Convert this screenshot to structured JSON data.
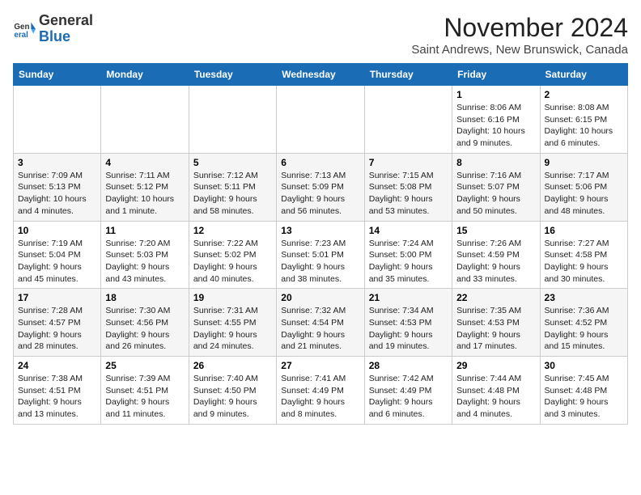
{
  "header": {
    "logo_general": "General",
    "logo_blue": "Blue",
    "month_title": "November 2024",
    "subtitle": "Saint Andrews, New Brunswick, Canada"
  },
  "days_of_week": [
    "Sunday",
    "Monday",
    "Tuesday",
    "Wednesday",
    "Thursday",
    "Friday",
    "Saturday"
  ],
  "weeks": [
    [
      {
        "day": "",
        "info": ""
      },
      {
        "day": "",
        "info": ""
      },
      {
        "day": "",
        "info": ""
      },
      {
        "day": "",
        "info": ""
      },
      {
        "day": "",
        "info": ""
      },
      {
        "day": "1",
        "info": "Sunrise: 8:06 AM\nSunset: 6:16 PM\nDaylight: 10 hours and 9 minutes."
      },
      {
        "day": "2",
        "info": "Sunrise: 8:08 AM\nSunset: 6:15 PM\nDaylight: 10 hours and 6 minutes."
      }
    ],
    [
      {
        "day": "3",
        "info": "Sunrise: 7:09 AM\nSunset: 5:13 PM\nDaylight: 10 hours and 4 minutes."
      },
      {
        "day": "4",
        "info": "Sunrise: 7:11 AM\nSunset: 5:12 PM\nDaylight: 10 hours and 1 minute."
      },
      {
        "day": "5",
        "info": "Sunrise: 7:12 AM\nSunset: 5:11 PM\nDaylight: 9 hours and 58 minutes."
      },
      {
        "day": "6",
        "info": "Sunrise: 7:13 AM\nSunset: 5:09 PM\nDaylight: 9 hours and 56 minutes."
      },
      {
        "day": "7",
        "info": "Sunrise: 7:15 AM\nSunset: 5:08 PM\nDaylight: 9 hours and 53 minutes."
      },
      {
        "day": "8",
        "info": "Sunrise: 7:16 AM\nSunset: 5:07 PM\nDaylight: 9 hours and 50 minutes."
      },
      {
        "day": "9",
        "info": "Sunrise: 7:17 AM\nSunset: 5:06 PM\nDaylight: 9 hours and 48 minutes."
      }
    ],
    [
      {
        "day": "10",
        "info": "Sunrise: 7:19 AM\nSunset: 5:04 PM\nDaylight: 9 hours and 45 minutes."
      },
      {
        "day": "11",
        "info": "Sunrise: 7:20 AM\nSunset: 5:03 PM\nDaylight: 9 hours and 43 minutes."
      },
      {
        "day": "12",
        "info": "Sunrise: 7:22 AM\nSunset: 5:02 PM\nDaylight: 9 hours and 40 minutes."
      },
      {
        "day": "13",
        "info": "Sunrise: 7:23 AM\nSunset: 5:01 PM\nDaylight: 9 hours and 38 minutes."
      },
      {
        "day": "14",
        "info": "Sunrise: 7:24 AM\nSunset: 5:00 PM\nDaylight: 9 hours and 35 minutes."
      },
      {
        "day": "15",
        "info": "Sunrise: 7:26 AM\nSunset: 4:59 PM\nDaylight: 9 hours and 33 minutes."
      },
      {
        "day": "16",
        "info": "Sunrise: 7:27 AM\nSunset: 4:58 PM\nDaylight: 9 hours and 30 minutes."
      }
    ],
    [
      {
        "day": "17",
        "info": "Sunrise: 7:28 AM\nSunset: 4:57 PM\nDaylight: 9 hours and 28 minutes."
      },
      {
        "day": "18",
        "info": "Sunrise: 7:30 AM\nSunset: 4:56 PM\nDaylight: 9 hours and 26 minutes."
      },
      {
        "day": "19",
        "info": "Sunrise: 7:31 AM\nSunset: 4:55 PM\nDaylight: 9 hours and 24 minutes."
      },
      {
        "day": "20",
        "info": "Sunrise: 7:32 AM\nSunset: 4:54 PM\nDaylight: 9 hours and 21 minutes."
      },
      {
        "day": "21",
        "info": "Sunrise: 7:34 AM\nSunset: 4:53 PM\nDaylight: 9 hours and 19 minutes."
      },
      {
        "day": "22",
        "info": "Sunrise: 7:35 AM\nSunset: 4:53 PM\nDaylight: 9 hours and 17 minutes."
      },
      {
        "day": "23",
        "info": "Sunrise: 7:36 AM\nSunset: 4:52 PM\nDaylight: 9 hours and 15 minutes."
      }
    ],
    [
      {
        "day": "24",
        "info": "Sunrise: 7:38 AM\nSunset: 4:51 PM\nDaylight: 9 hours and 13 minutes."
      },
      {
        "day": "25",
        "info": "Sunrise: 7:39 AM\nSunset: 4:51 PM\nDaylight: 9 hours and 11 minutes."
      },
      {
        "day": "26",
        "info": "Sunrise: 7:40 AM\nSunset: 4:50 PM\nDaylight: 9 hours and 9 minutes."
      },
      {
        "day": "27",
        "info": "Sunrise: 7:41 AM\nSunset: 4:49 PM\nDaylight: 9 hours and 8 minutes."
      },
      {
        "day": "28",
        "info": "Sunrise: 7:42 AM\nSunset: 4:49 PM\nDaylight: 9 hours and 6 minutes."
      },
      {
        "day": "29",
        "info": "Sunrise: 7:44 AM\nSunset: 4:48 PM\nDaylight: 9 hours and 4 minutes."
      },
      {
        "day": "30",
        "info": "Sunrise: 7:45 AM\nSunset: 4:48 PM\nDaylight: 9 hours and 3 minutes."
      }
    ]
  ]
}
